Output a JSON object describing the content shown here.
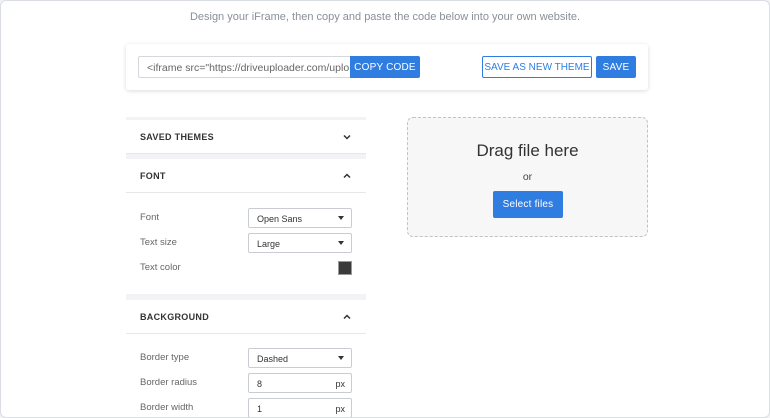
{
  "intro_text": "Design your iFrame, then copy and paste the code below into your own website.",
  "code_bar": {
    "code_value": "<iframe src=\"https://driveuploader.com/uplo",
    "copy_label": "COPY CODE",
    "save_new_theme_label": "SAVE AS NEW THEME",
    "save_label": "SAVE"
  },
  "panel": {
    "saved_themes": {
      "title": "SAVED THEMES",
      "icon": "chevron-down-icon"
    },
    "font": {
      "title": "FONT",
      "icon": "chevron-up-icon",
      "font_label": "Font",
      "font_value": "Open Sans",
      "text_size_label": "Text size",
      "text_size_value": "Large",
      "text_color_label": "Text color",
      "text_color_value": "#3a3a3a"
    },
    "background": {
      "title": "BACKGROUND",
      "icon": "chevron-up-icon",
      "border_type_label": "Border type",
      "border_type_value": "Dashed",
      "border_radius_label": "Border radius",
      "border_radius_value": "8",
      "border_width_label": "Border width",
      "border_width_value": "1",
      "unit": "px"
    }
  },
  "preview": {
    "title": "Drag file here",
    "or_text": "or",
    "select_label": "Select files"
  },
  "colors": {
    "accent": "#2f7de1"
  }
}
